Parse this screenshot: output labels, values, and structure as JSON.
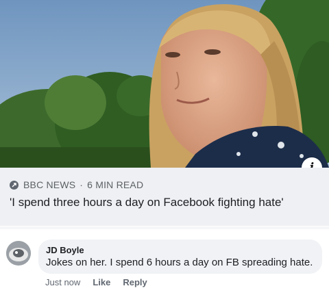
{
  "post": {
    "photo_icon": "woman-portrait-photo",
    "info_icon_glyph": "i",
    "link": {
      "source_icon": "bbc-news-logo-icon",
      "source": "BBC NEWS",
      "separator": "·",
      "read_time": "6 MIN READ",
      "headline": "'I spend three hours a day on Facebook fighting hate'"
    }
  },
  "comment": {
    "avatar_icon": "avatar-photo",
    "author": "JD Boyle",
    "text": "Jokes on her. I spend 6 hours a day on FB spreading hate.",
    "timestamp": "Just now",
    "like_label": "Like",
    "reply_label": "Reply"
  },
  "colors": {
    "card_background": "#eef0f3",
    "bubble_background": "#f0f2f5",
    "meta_text": "#606770",
    "primary_text": "#1c1e21"
  }
}
